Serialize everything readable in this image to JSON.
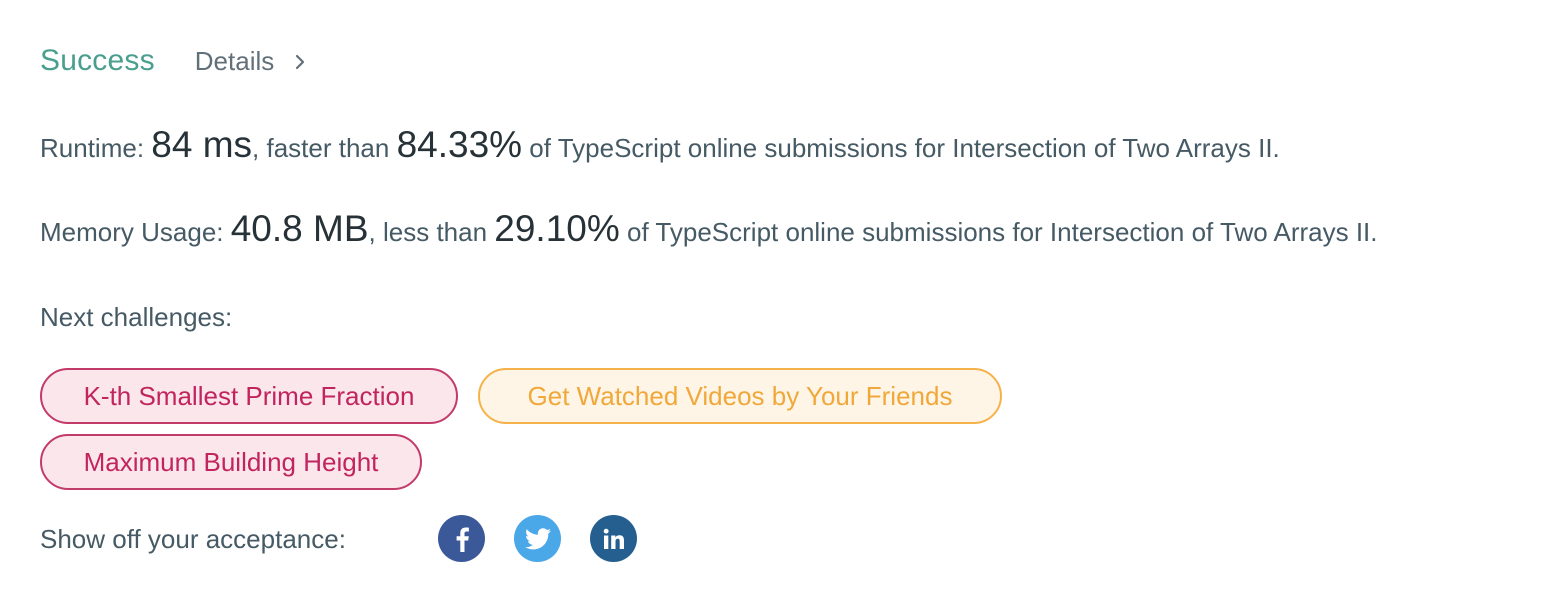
{
  "result": {
    "status": "Success",
    "details_label": "Details"
  },
  "runtime": {
    "label": "Runtime: ",
    "value": "84 ms",
    "comparison": ", faster than ",
    "percent": "84.33%",
    "suffix": " of TypeScript online submissions for Intersection of Two Arrays II."
  },
  "memory": {
    "label": "Memory Usage: ",
    "value": "40.8 MB",
    "comparison": ", less than ",
    "percent": "29.10%",
    "suffix": " of TypeScript online submissions for Intersection of Two Arrays II."
  },
  "next": {
    "label": "Next challenges:",
    "challenges": [
      {
        "title": "K-th Smallest Prime Fraction",
        "difficulty": "hard"
      },
      {
        "title": "Get Watched Videos by Your Friends",
        "difficulty": "medium"
      },
      {
        "title": "Maximum Building Height",
        "difficulty": "hard"
      }
    ]
  },
  "share": {
    "label": "Show off your acceptance:",
    "networks": [
      "facebook-icon",
      "twitter-icon",
      "linkedin-icon"
    ]
  },
  "colors": {
    "success": "#4a9e8e",
    "hard": "#c2245e",
    "medium": "#f0a83a",
    "facebook": "#3b5998",
    "twitter": "#4aa7e8",
    "linkedin": "#255f8f"
  }
}
